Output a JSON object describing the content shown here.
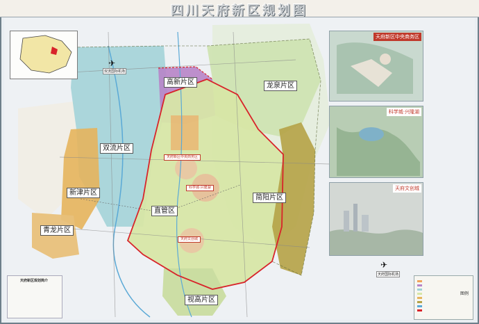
{
  "title": "四川天府新区规划图",
  "districts": {
    "gaoxin": "高新片区",
    "longquan": "龙泉片区",
    "shuangliu": "双流片区",
    "xinjin": "新津片区",
    "qinglong": "青龙片区",
    "zhiguan": "直管区",
    "jianyang": "简阳片区",
    "meishan": "视高片区"
  },
  "zones": {
    "center": "天府新区中央商务区",
    "science": "科学城·兴隆湖",
    "culture": "天府文创城"
  },
  "panels": [
    {
      "title": "天府新区中央商务区",
      "color": "#ffffff",
      "bg": "#c0392b"
    },
    {
      "title": "科学城·兴隆湖",
      "color": "#c0392b",
      "bg": "#ffffff"
    },
    {
      "title": "天府文创城",
      "color": "#c0392b",
      "bg": "#ffffff"
    }
  ],
  "legend_title": "图例",
  "notes_title": "天府新区规划简介",
  "colors": {
    "zhiguan": "#d7e6a6",
    "gaoxin": "#b784c8",
    "longquan": "#cfe3b2",
    "shuangliu": "#9fd1d6",
    "xinjin": "#e6b45c",
    "qinglong": "#e8c07a",
    "jianyang": "#b5a246",
    "border": "#d8232a"
  }
}
